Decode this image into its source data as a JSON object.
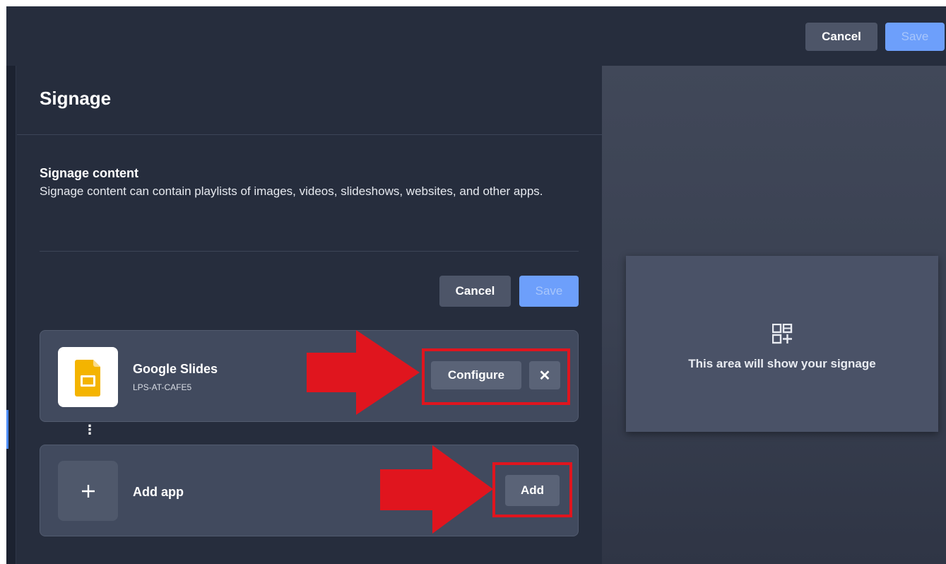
{
  "header": {
    "cancel_label": "Cancel",
    "save_label": "Save"
  },
  "page": {
    "title": "Signage"
  },
  "section": {
    "title": "Signage content",
    "description": "Signage content can contain playlists of images, videos, slideshows, websites, and other apps.",
    "cancel_label": "Cancel",
    "save_label": "Save"
  },
  "apps": [
    {
      "name": "Google Slides",
      "subtitle": "LPS-AT-CAFE5",
      "icon": "google-slides-icon",
      "configure_label": "Configure",
      "remove_label": "✕"
    }
  ],
  "add_app": {
    "label": "Add app",
    "icon": "plus-icon",
    "button_label": "Add"
  },
  "preview": {
    "icon": "add-widget-icon",
    "text": "This area will show your signage"
  },
  "colors": {
    "accent": "#6d9ffb",
    "annotation_red": "#e0151e",
    "panel": "#262d3d",
    "card": "#414a5e"
  }
}
